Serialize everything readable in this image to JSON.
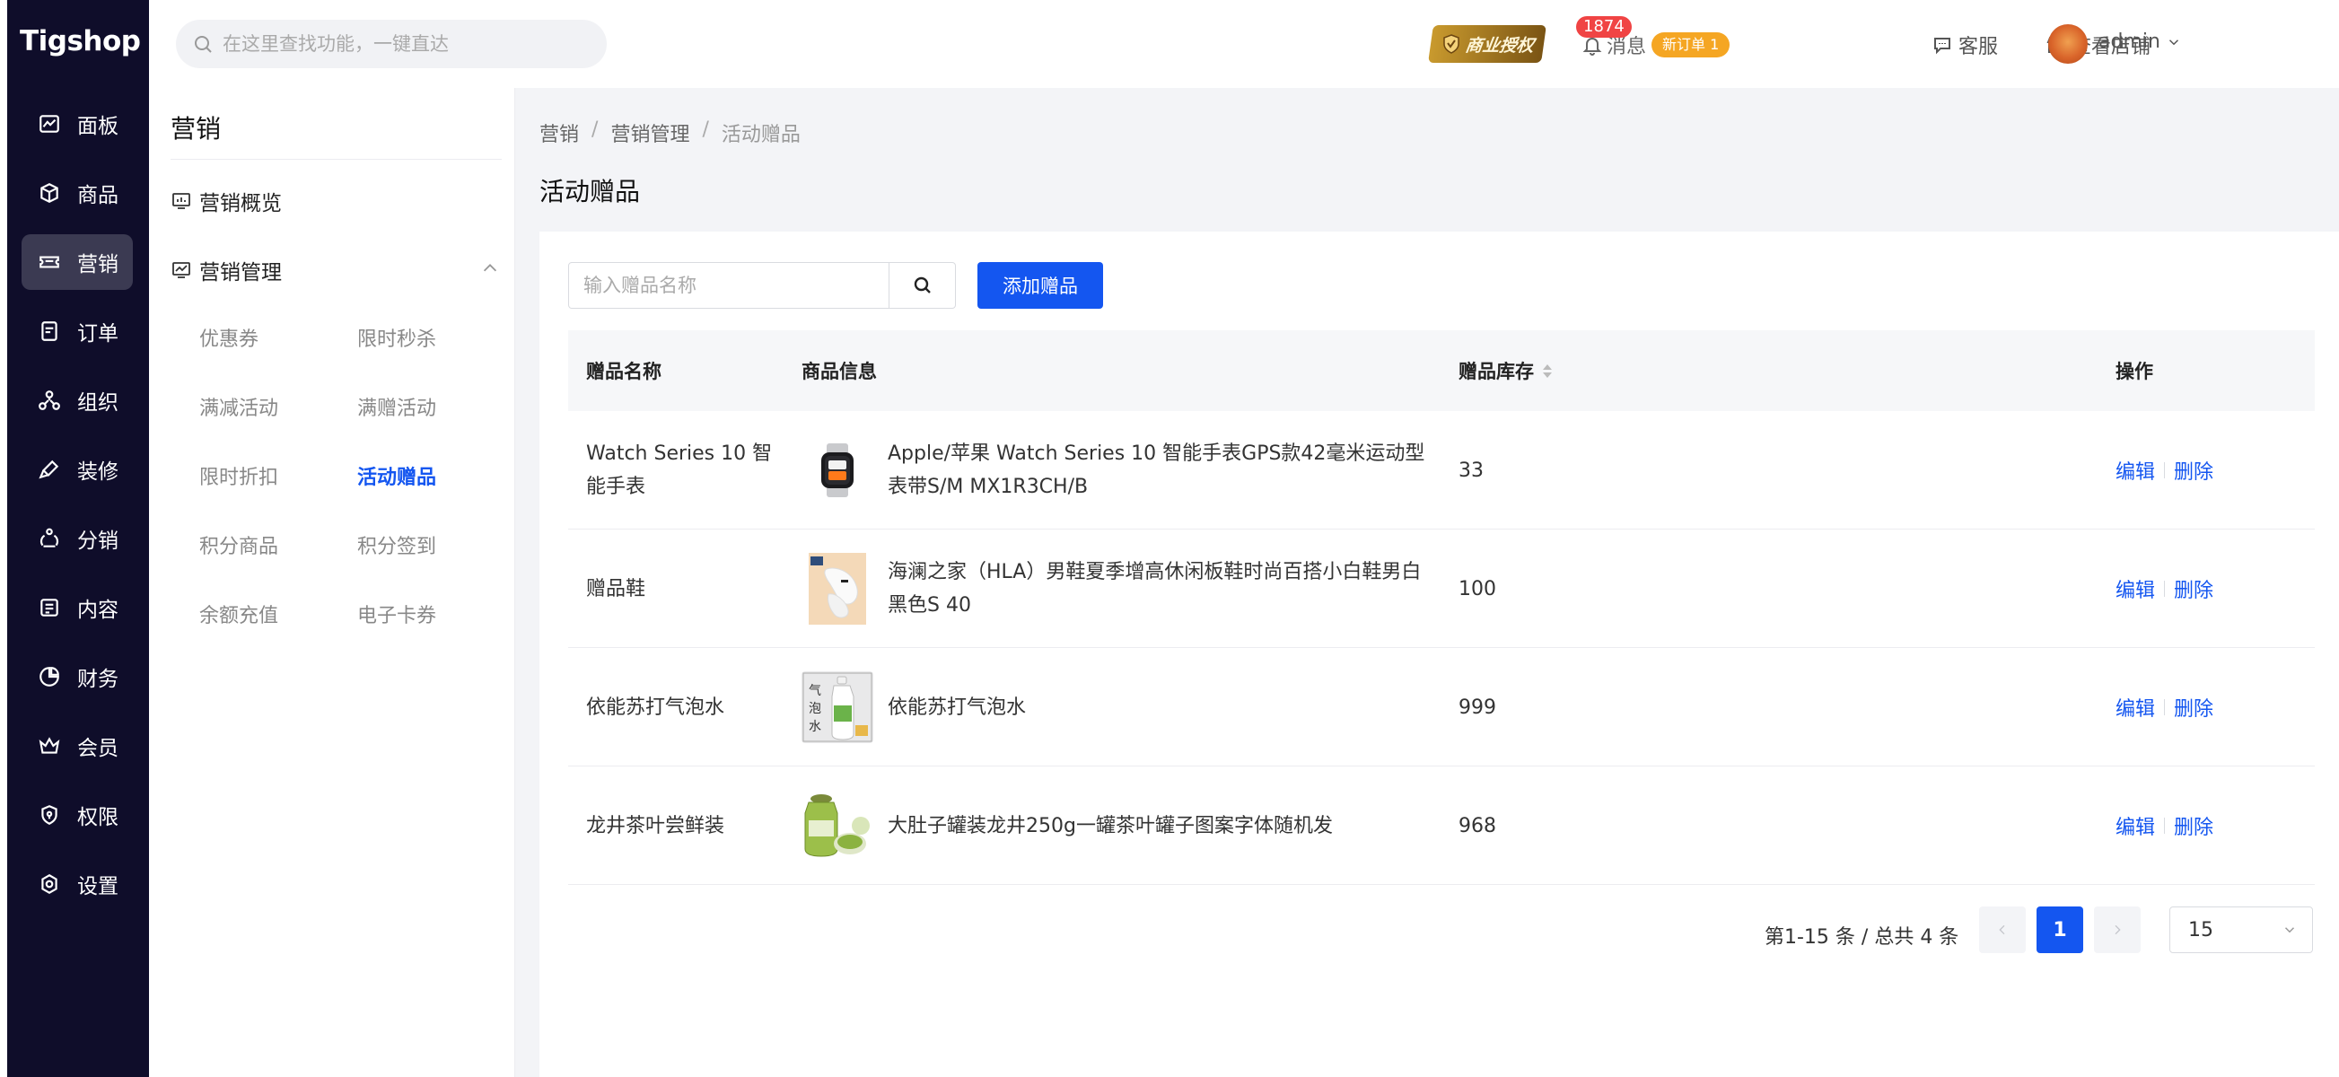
{
  "app": {
    "logo": "Tigshop"
  },
  "sidebar": {
    "items": [
      {
        "label": "面板",
        "icon": "dashboard-icon"
      },
      {
        "label": "商品",
        "icon": "box-icon"
      },
      {
        "label": "营销",
        "icon": "ticket-icon",
        "active": true
      },
      {
        "label": "订单",
        "icon": "order-icon"
      },
      {
        "label": "组织",
        "icon": "org-icon"
      },
      {
        "label": "装修",
        "icon": "brush-icon"
      },
      {
        "label": "分销",
        "icon": "share-icon"
      },
      {
        "label": "内容",
        "icon": "content-icon"
      },
      {
        "label": "财务",
        "icon": "finance-icon"
      },
      {
        "label": "会员",
        "icon": "crown-icon"
      },
      {
        "label": "权限",
        "icon": "shield-icon"
      },
      {
        "label": "设置",
        "icon": "settings-icon"
      }
    ]
  },
  "subnav": {
    "title": "营销",
    "overview": "营销概览",
    "management": "营销管理",
    "links": [
      {
        "label": "优惠券"
      },
      {
        "label": "限时秒杀"
      },
      {
        "label": "满减活动"
      },
      {
        "label": "满赠活动"
      },
      {
        "label": "限时折扣"
      },
      {
        "label": "活动赠品",
        "active": true
      },
      {
        "label": "积分商品"
      },
      {
        "label": "积分签到"
      },
      {
        "label": "余额充值"
      },
      {
        "label": "电子卡券"
      }
    ]
  },
  "topbar": {
    "search_placeholder": "在这里查找功能，一键直达",
    "license_label": "商业授权",
    "message_label": "消息",
    "message_count": "1874",
    "new_order_label": "新订单 1",
    "service_label": "客服",
    "store_label": "查看店铺",
    "user_label": "admin"
  },
  "breadcrumb": {
    "items": [
      "营销",
      "营销管理",
      "活动赠品"
    ],
    "separator": "/"
  },
  "page": {
    "title": "活动赠品",
    "filter_placeholder": "输入赠品名称",
    "add_button": "添加赠品"
  },
  "table": {
    "columns": {
      "name": "赠品名称",
      "info": "商品信息",
      "stock": "赠品库存",
      "op": "操作"
    },
    "edit_label": "编辑",
    "delete_label": "删除",
    "rows": [
      {
        "name": "Watch Series 10 智能手表",
        "info": "Apple/苹果 Watch Series 10 智能手表GPS款42毫米运动型表带S/M MX1R3CH/B",
        "stock": "33",
        "thumb": "watch"
      },
      {
        "name": "赠品鞋",
        "info": "海澜之家（HLA）男鞋夏季增高休闲板鞋时尚百搭小白鞋男白黑色S 40",
        "stock": "100",
        "thumb": "shoe"
      },
      {
        "name": "依能苏打气泡水",
        "info": "依能苏打气泡水",
        "stock": "999",
        "thumb": "bottle"
      },
      {
        "name": "龙井茶叶尝鲜装",
        "info": "大肚子罐装龙井250g一罐茶叶罐子图案字体随机发",
        "stock": "968",
        "thumb": "tea"
      }
    ]
  },
  "pagination": {
    "summary": "第1-15 条 / 总共 4 条",
    "current_page": "1",
    "page_size": "15"
  },
  "colors": {
    "accent": "#1456f0",
    "sidebar_bg": "#0f0d2a",
    "badge_red": "#f04444",
    "badge_orange": "#f5a623"
  }
}
